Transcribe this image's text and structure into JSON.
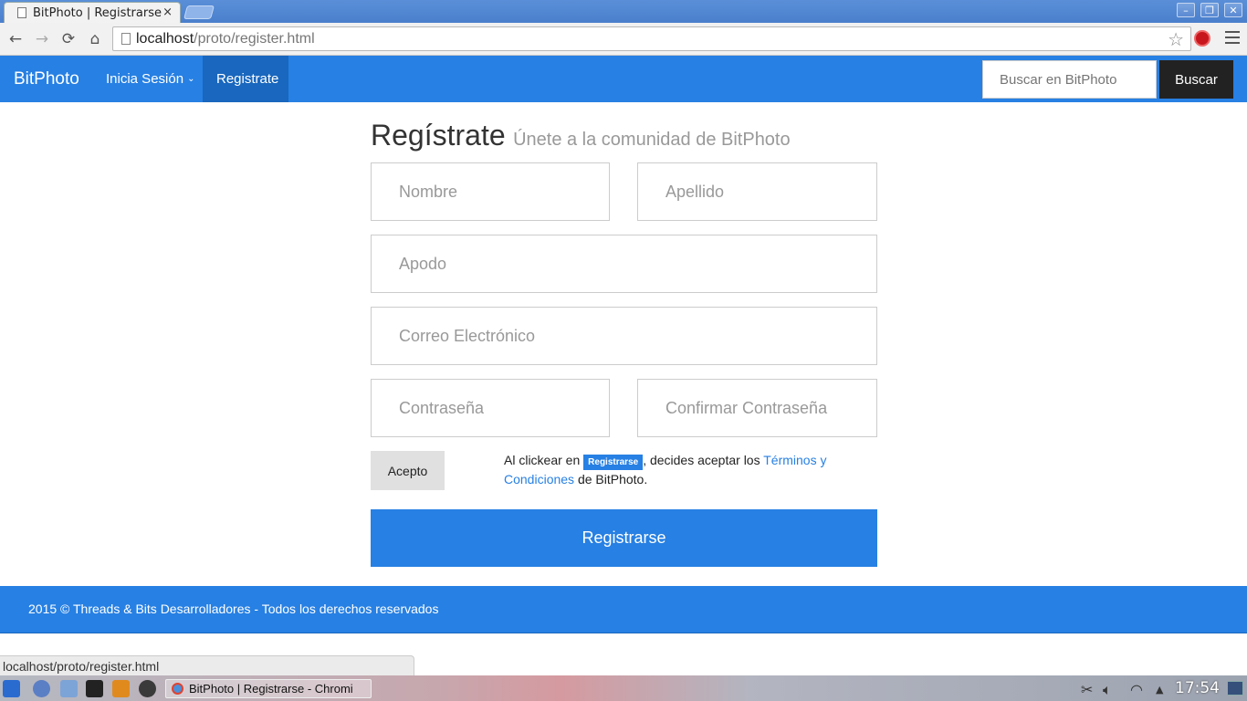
{
  "browser": {
    "tab_title": "BitPhoto | Registrarse",
    "tab_close": "×",
    "url_host": "localhost",
    "url_path": "/proto/register.html",
    "status_url": "localhost/proto/register.html"
  },
  "navbar": {
    "brand": "BitPhoto",
    "login_label": "Inicia Sesión",
    "register_label": "Registrate",
    "search_placeholder": "Buscar en BitPhoto",
    "search_button": "Buscar"
  },
  "form": {
    "title": "Regístrate",
    "subtitle": "Únete a la comunidad de BitPhoto",
    "first_name_placeholder": "Nombre",
    "last_name_placeholder": "Apellido",
    "nickname_placeholder": "Apodo",
    "email_placeholder": "Correo Electrónico",
    "password_placeholder": "Contraseña",
    "confirm_password_placeholder": "Confirmar Contraseña",
    "accept_button": "Acepto",
    "terms_prefix": "Al clickear en",
    "terms_label": "Registrarse",
    "terms_middle": ", decides aceptar los",
    "terms_link": "Términos y Condiciones",
    "terms_suffix": "de BitPhoto.",
    "submit_button": "Registrarse"
  },
  "footer": {
    "text": "2015 © Threads & Bits Desarrolladores - Todos los derechos reservados"
  },
  "taskbar": {
    "window_title": "BitPhoto | Registrarse - Chromi",
    "clock": "17:54"
  },
  "colors": {
    "primary": "#2780e3",
    "primary_dark": "#1967be",
    "dark_button": "#222222"
  }
}
